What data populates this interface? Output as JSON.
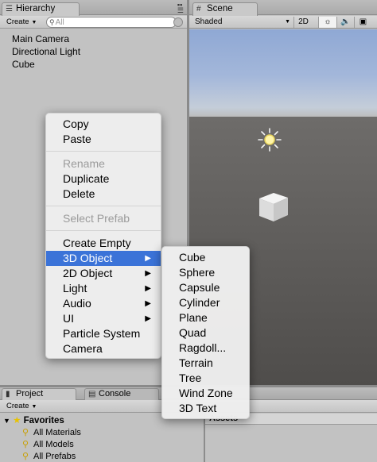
{
  "hierarchy": {
    "tab_label": "Hierarchy",
    "create_label": "Create",
    "search_placeholder": "All",
    "items": [
      "Main Camera",
      "Directional Light",
      "Cube"
    ]
  },
  "scene": {
    "tab_label": "Scene",
    "shading_mode": "Shaded",
    "mode_2d_label": "2D",
    "lighting_icon": "sun-icon",
    "audio_icon": "speaker-icon"
  },
  "context_menu": {
    "items": [
      {
        "label": "Copy",
        "enabled": true
      },
      {
        "label": "Paste",
        "enabled": true
      },
      {
        "separator": true
      },
      {
        "label": "Rename",
        "enabled": false
      },
      {
        "label": "Duplicate",
        "enabled": true
      },
      {
        "label": "Delete",
        "enabled": true
      },
      {
        "separator": true
      },
      {
        "label": "Select Prefab",
        "enabled": false
      },
      {
        "separator": true
      },
      {
        "label": "Create Empty",
        "enabled": true
      },
      {
        "label": "3D Object",
        "enabled": true,
        "submenu": true,
        "highlighted": true
      },
      {
        "label": "2D Object",
        "enabled": true,
        "submenu": true
      },
      {
        "label": "Light",
        "enabled": true,
        "submenu": true
      },
      {
        "label": "Audio",
        "enabled": true,
        "submenu": true
      },
      {
        "label": "UI",
        "enabled": true,
        "submenu": true
      },
      {
        "label": "Particle System",
        "enabled": true
      },
      {
        "label": "Camera",
        "enabled": true
      }
    ]
  },
  "submenu_3d": {
    "items": [
      "Cube",
      "Sphere",
      "Capsule",
      "Cylinder",
      "Plane",
      "Quad",
      "Ragdoll...",
      "Terrain",
      "Tree",
      "Wind Zone",
      "3D Text"
    ]
  },
  "project": {
    "tab_label": "Project",
    "console_tab_label": "Console",
    "create_label": "Create",
    "favorites_label": "Favorites",
    "favorites": [
      "All Materials",
      "All Models",
      "All Prefabs"
    ],
    "assets_label": "Assets"
  },
  "colors": {
    "menu_highlight": "#3b73d8",
    "sky_top": "#8fa8d4",
    "ground": "#5f5d5b"
  }
}
